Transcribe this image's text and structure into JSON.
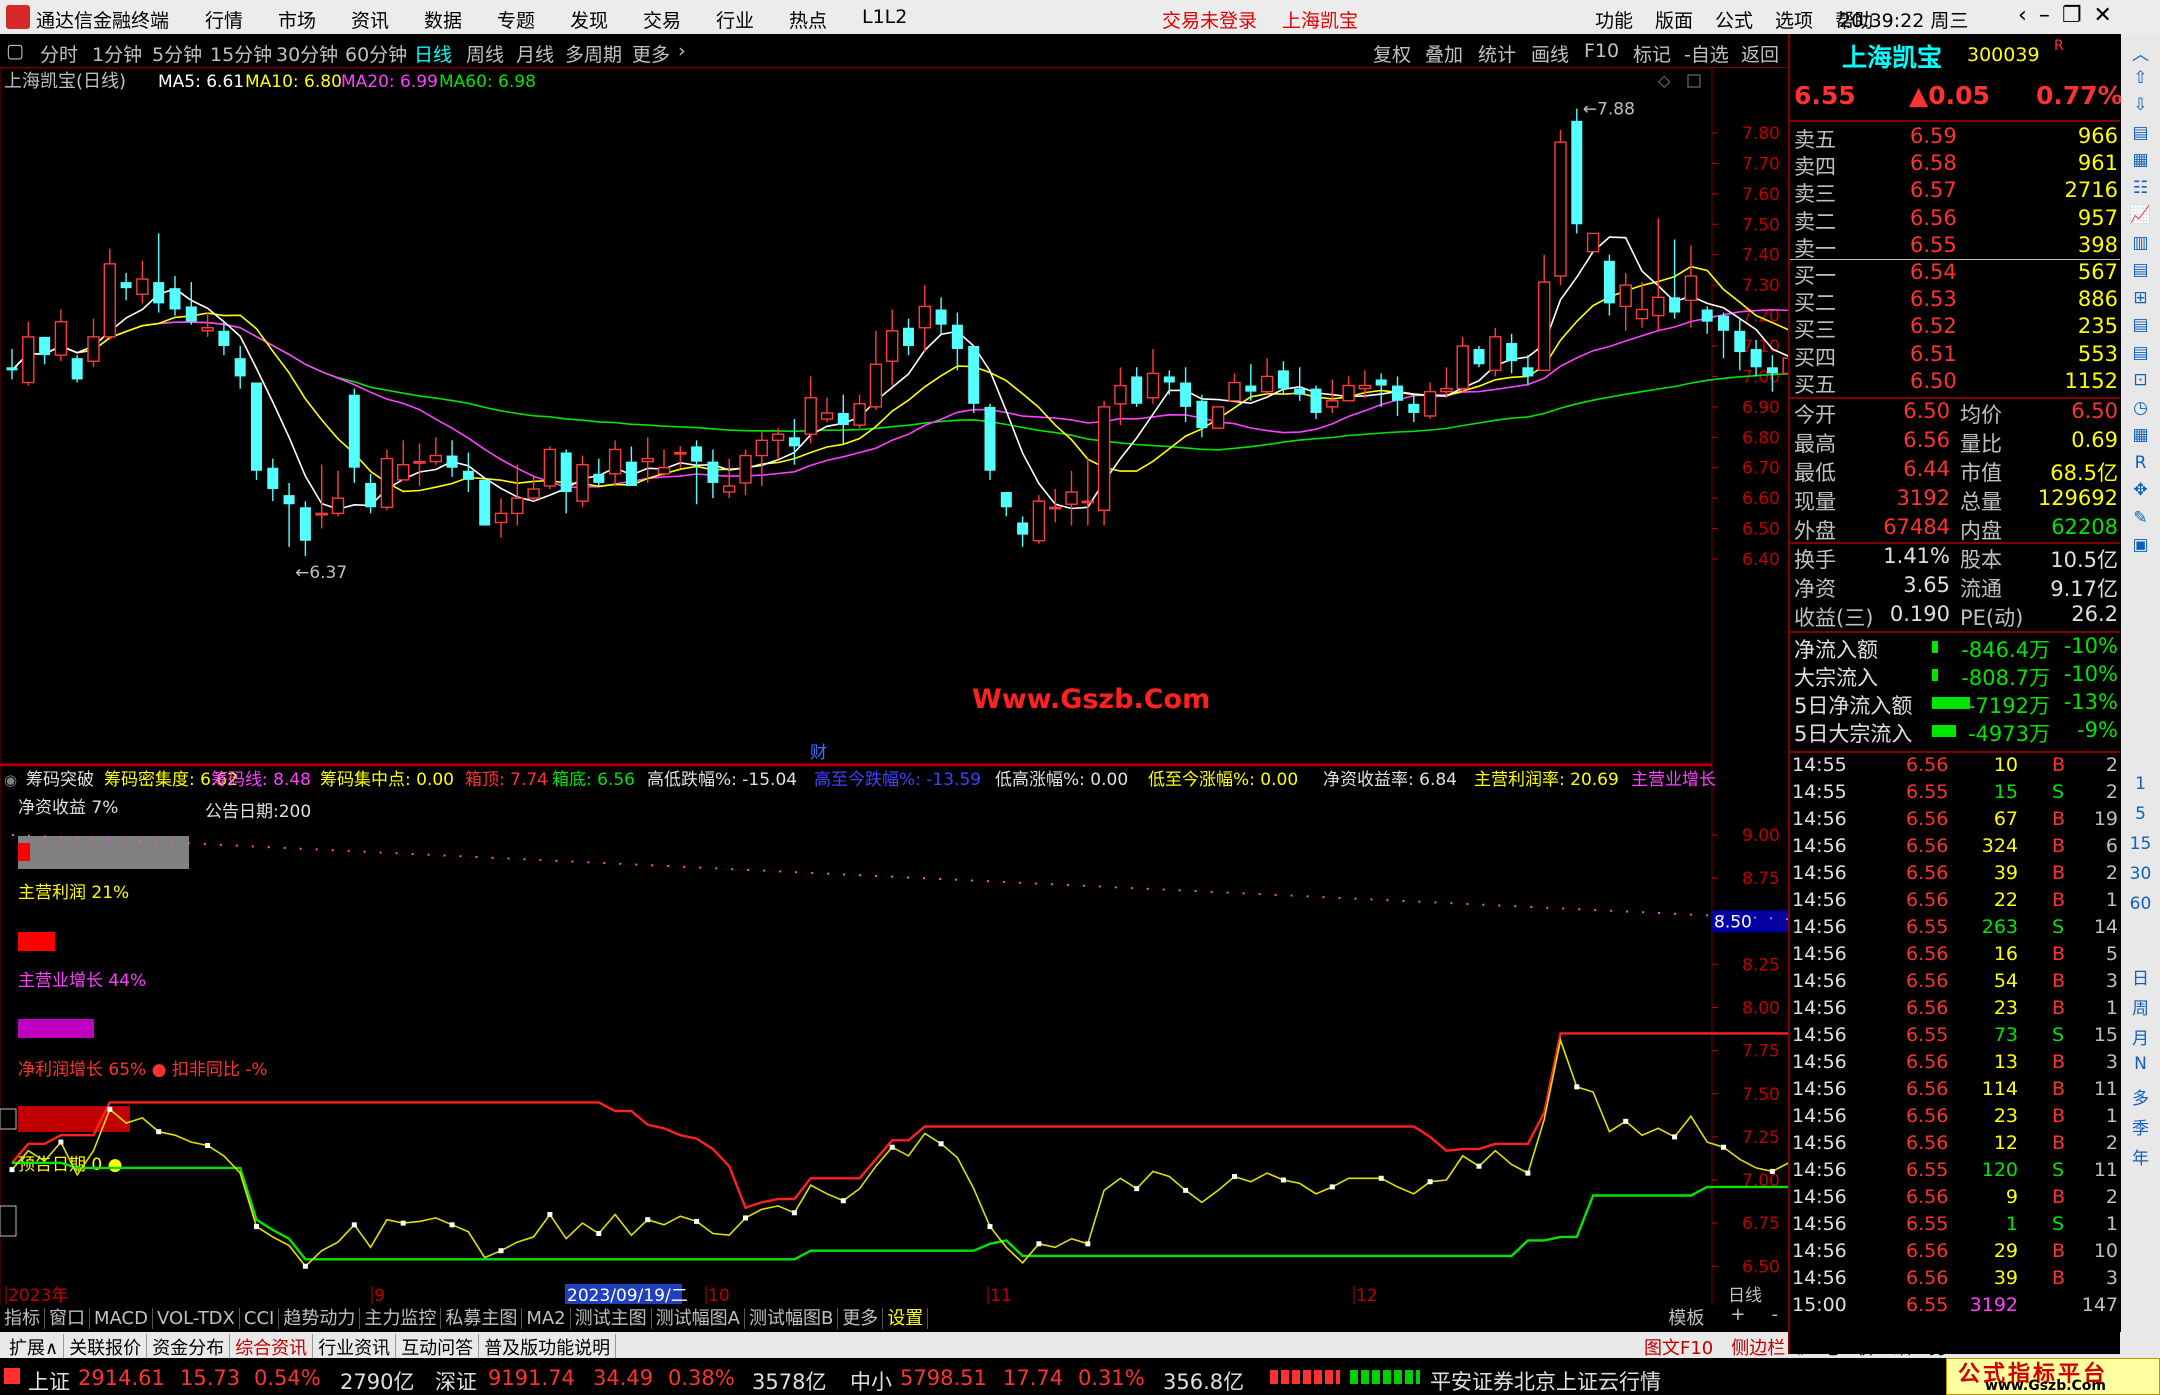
{
  "app": {
    "name": "通达信金融终端",
    "menu": [
      "行情",
      "市场",
      "资讯",
      "数据",
      "专题",
      "发现",
      "交易",
      "行业",
      "热点",
      "L1L2"
    ],
    "trade_status": "交易未登录",
    "stock_title": "上海凯宝",
    "sys_menu": [
      "功能",
      "版面",
      "公式",
      "选项",
      "帮助"
    ],
    "time": "20:39:22",
    "weekday": "周三"
  },
  "periods": [
    "分时",
    "1分钟",
    "5分钟",
    "15分钟",
    "30分钟",
    "60分钟",
    "日线",
    "周线",
    "月线",
    "多周期",
    "更多"
  ],
  "active_period": "日线",
  "tools": [
    "复权",
    "叠加",
    "统计",
    "画线",
    "F10",
    "标记",
    "-自选",
    "返回"
  ],
  "chart": {
    "title": "上海凯宝(日线)",
    "ma5": "MA5: 6.61",
    "ma10": "MA10: 6.80",
    "ma20": "MA20: 6.99",
    "ma60": "MA60: 6.98",
    "high_label": "7.88",
    "low_label": "6.37",
    "watermark": "Www.Gszb.Com",
    "cai": "财",
    "y_ticks": [
      "7.80",
      "7.70",
      "7.60",
      "7.50",
      "7.40",
      "7.30",
      "7.20",
      "7.10",
      "7.00",
      "6.90",
      "6.80",
      "6.70",
      "6.60",
      "6.50",
      "6.40"
    ]
  },
  "indicator": {
    "name": "筹码突破",
    "items": [
      {
        "t": "筹码密集度: 6.62",
        "c": "#ffff00"
      },
      {
        "t": "筹码线: 8.48",
        "c": "#ff40ff"
      },
      {
        "t": "筹码集中点: 0.00",
        "c": "#ffff00"
      },
      {
        "t": "箱顶: 7.74",
        "c": "#ff3232"
      },
      {
        "t": "箱底: 6.56",
        "c": "#00e600"
      },
      {
        "t": "高低跌幅%: -15.04",
        "c": "#e0e0e0"
      },
      {
        "t": "高至今跌幅%: -13.59",
        "c": "#4040ff"
      },
      {
        "t": "低高涨幅%: 0.00",
        "c": "#e0e0e0"
      },
      {
        "t": "低至今涨幅%: 0.00",
        "c": "#ffff00"
      },
      {
        "t": "净资收益率: 6.84",
        "c": "#e0e0e0"
      },
      {
        "t": "主营利润率: 20.69",
        "c": "#ffff00"
      },
      {
        "t": "主营业增长",
        "c": "#ff40ff"
      }
    ],
    "jzsy": "净资收益 7%",
    "ggrq": "公告日期:200",
    "zylr": "主营利润 21%",
    "zyzz": "主营业增长 44%",
    "jlrzz": "净利润增长 65%",
    "kfyb": "扣非同比 -%",
    "ygrq": "预告日期 0",
    "y_ticks": [
      "9.00",
      "8.75",
      "8.50",
      "8.25",
      "8.00",
      "7.75",
      "7.50",
      "7.25",
      "7.00",
      "6.75",
      "6.50"
    ],
    "cur": "8.50"
  },
  "xaxis": {
    "year": "2023年",
    "m9": "9",
    "date": "2023/09/19/二",
    "m10": "10",
    "m11": "11",
    "m12": "12",
    "period": "日线"
  },
  "bottom_tabs": [
    "指标",
    "窗口",
    "MACD",
    "VOL-TDX",
    "CCI",
    "趋势动力",
    "主力监控",
    "私募主图",
    "MA2",
    "测试主图",
    "测试幅图A",
    "测试幅图B",
    "更多",
    "设置"
  ],
  "bottom_right": [
    "模板",
    "+",
    "-"
  ],
  "tabs2": [
    "扩展∧",
    "关联报价",
    "资金分布",
    "综合资讯",
    "行业资讯",
    "互动问答",
    "普及版功能说明"
  ],
  "tabs2_right": [
    "图文F10",
    "侧边栏《",
    "笔",
    "价",
    "细",
    "势"
  ],
  "quote": {
    "name": "上海凯宝",
    "code": "300039",
    "price": "6.55",
    "change": "▲0.05",
    "pct": "0.77%",
    "asks": [
      [
        "卖五",
        "6.59",
        "966"
      ],
      [
        "卖四",
        "6.58",
        "961"
      ],
      [
        "卖三",
        "6.57",
        "2716"
      ],
      [
        "卖二",
        "6.56",
        "957"
      ],
      [
        "卖一",
        "6.55",
        "398"
      ]
    ],
    "bids": [
      [
        "买一",
        "6.54",
        "567"
      ],
      [
        "买二",
        "6.53",
        "886"
      ],
      [
        "买三",
        "6.52",
        "235"
      ],
      [
        "买四",
        "6.51",
        "553"
      ],
      [
        "买五",
        "6.50",
        "1152"
      ]
    ],
    "stats": [
      [
        "今开",
        "6.50",
        "均价",
        "6.50"
      ],
      [
        "最高",
        "6.56",
        "量比",
        "0.69"
      ],
      [
        "最低",
        "6.44",
        "市值",
        "68.5亿"
      ],
      [
        "现量",
        "3192",
        "总量",
        "129692"
      ],
      [
        "外盘",
        "67484",
        "内盘",
        "62208"
      ]
    ],
    "stats2": [
      [
        "换手",
        "1.41%",
        "股本",
        "10.5亿"
      ],
      [
        "净资",
        "3.65",
        "流通",
        "9.17亿"
      ],
      [
        "收益(三)",
        "0.190",
        "PE(动)",
        "26.2"
      ]
    ],
    "flows": [
      [
        "净流入额",
        "-846.4万",
        "-10%"
      ],
      [
        "大宗流入",
        "-808.7万",
        "-10%"
      ],
      [
        "5日净流入额",
        "-7192万",
        "-13%"
      ],
      [
        "5日大宗流入",
        "-4973万",
        "-9%"
      ]
    ],
    "ticks": [
      [
        "14:55",
        "6.56",
        "10",
        "B",
        "2"
      ],
      [
        "14:55",
        "6.55",
        "15",
        "S",
        "2"
      ],
      [
        "14:56",
        "6.56",
        "67",
        "B",
        "19"
      ],
      [
        "14:56",
        "6.56",
        "324",
        "B",
        "6"
      ],
      [
        "14:56",
        "6.56",
        "39",
        "B",
        "2"
      ],
      [
        "14:56",
        "6.56",
        "22",
        "B",
        "1"
      ],
      [
        "14:56",
        "6.55",
        "263",
        "S",
        "14"
      ],
      [
        "14:56",
        "6.56",
        "16",
        "B",
        "5"
      ],
      [
        "14:56",
        "6.56",
        "54",
        "B",
        "3"
      ],
      [
        "14:56",
        "6.56",
        "23",
        "B",
        "1"
      ],
      [
        "14:56",
        "6.55",
        "73",
        "S",
        "15"
      ],
      [
        "14:56",
        "6.56",
        "13",
        "B",
        "3"
      ],
      [
        "14:56",
        "6.56",
        "114",
        "B",
        "11"
      ],
      [
        "14:56",
        "6.56",
        "23",
        "B",
        "1"
      ],
      [
        "14:56",
        "6.56",
        "12",
        "B",
        "2"
      ],
      [
        "14:56",
        "6.55",
        "120",
        "S",
        "11"
      ],
      [
        "14:56",
        "6.56",
        "9",
        "B",
        "2"
      ],
      [
        "14:56",
        "6.55",
        "1",
        "S",
        "1"
      ],
      [
        "14:56",
        "6.56",
        "29",
        "B",
        "10"
      ],
      [
        "14:56",
        "6.56",
        "39",
        "B",
        "3"
      ],
      [
        "15:00",
        "6.55",
        "3192",
        "",
        "147"
      ]
    ]
  },
  "sidebar": [
    "日",
    "周",
    "月",
    "N",
    "多",
    "季",
    "年"
  ],
  "sidebar_nums": [
    "1",
    "5",
    "15",
    "30",
    "60"
  ],
  "status": {
    "sh_label": "上证",
    "sh": "2914.61",
    "sh_chg": "15.73",
    "sh_pct": "0.54%",
    "sh_amt": "2790亿",
    "sz_label": "深证",
    "sz": "9191.74",
    "sz_chg": "34.49",
    "sz_pct": "0.38%",
    "sz_amt": "3578亿",
    "zx_label": "中小",
    "zx": "5798.51",
    "zx_chg": "17.74",
    "zx_pct": "0.31%",
    "zx_amt": "356.8亿",
    "broker": "平安证券北京上证云行情",
    "brand": "公式指标平台",
    "brand_url": "www.Gszb.Com"
  },
  "chart_data": {
    "type": "candlestick",
    "ma_colors": {
      "ma5": "#ffffff",
      "ma10": "#ffff00",
      "ma20": "#ff40ff",
      "ma60": "#00e600"
    },
    "candles": [
      [
        7.03,
        7.02,
        7.09,
        6.99
      ],
      [
        6.98,
        7.13,
        7.18,
        6.97
      ],
      [
        7.13,
        7.07,
        7.11,
        7.04
      ],
      [
        7.07,
        7.18,
        7.22,
        7.05
      ],
      [
        7.06,
        6.99,
        7.07,
        6.98
      ],
      [
        7.05,
        7.13,
        7.19,
        7.03
      ],
      [
        7.13,
        7.37,
        7.42,
        7.12
      ],
      [
        7.31,
        7.29,
        7.34,
        7.25
      ],
      [
        7.27,
        7.32,
        7.38,
        7.24
      ],
      [
        7.31,
        7.24,
        7.47,
        7.21
      ],
      [
        7.29,
        7.22,
        7.33,
        7.2
      ],
      [
        7.23,
        7.18,
        7.31,
        7.17
      ],
      [
        7.15,
        7.16,
        7.21,
        7.13
      ],
      [
        7.15,
        7.1,
        7.18,
        7.07
      ],
      [
        7.06,
        7.0,
        7.1,
        6.96
      ],
      [
        6.98,
        6.69,
        6.98,
        6.66
      ],
      [
        6.7,
        6.63,
        6.73,
        6.59
      ],
      [
        6.61,
        6.58,
        6.65,
        6.44
      ],
      [
        6.57,
        6.46,
        6.59,
        6.41
      ],
      [
        6.55,
        6.55,
        6.71,
        6.5
      ],
      [
        6.55,
        6.6,
        6.69,
        6.54
      ],
      [
        6.94,
        6.7,
        6.96,
        6.65
      ],
      [
        6.65,
        6.57,
        6.68,
        6.55
      ],
      [
        6.57,
        6.73,
        6.76,
        6.56
      ],
      [
        6.66,
        6.71,
        6.79,
        6.66
      ],
      [
        6.72,
        6.72,
        6.78,
        6.64
      ],
      [
        6.72,
        6.74,
        6.8,
        6.71
      ],
      [
        6.74,
        6.7,
        6.79,
        6.67
      ],
      [
        6.69,
        6.66,
        6.75,
        6.62
      ],
      [
        6.66,
        6.51,
        6.66,
        6.51
      ],
      [
        6.52,
        6.55,
        6.6,
        6.47
      ],
      [
        6.55,
        6.6,
        6.71,
        6.51
      ],
      [
        6.6,
        6.63,
        6.67,
        6.59
      ],
      [
        6.64,
        6.76,
        6.77,
        6.63
      ],
      [
        6.75,
        6.62,
        6.76,
        6.55
      ],
      [
        6.59,
        6.71,
        6.74,
        6.57
      ],
      [
        6.68,
        6.65,
        6.73,
        6.64
      ],
      [
        6.68,
        6.76,
        6.79,
        6.64
      ],
      [
        6.72,
        6.64,
        6.77,
        6.64
      ],
      [
        6.72,
        6.73,
        6.8,
        6.65
      ],
      [
        6.68,
        6.7,
        6.76,
        6.67
      ],
      [
        6.75,
        6.75,
        6.77,
        6.7
      ],
      [
        6.77,
        6.72,
        6.79,
        6.58
      ],
      [
        6.72,
        6.65,
        6.76,
        6.6
      ],
      [
        6.62,
        6.64,
        6.73,
        6.6
      ],
      [
        6.65,
        6.74,
        6.76,
        6.61
      ],
      [
        6.74,
        6.79,
        6.82,
        6.64
      ],
      [
        6.79,
        6.81,
        6.83,
        6.73
      ],
      [
        6.8,
        6.77,
        6.86,
        6.71
      ],
      [
        6.81,
        6.93,
        7.0,
        6.78
      ],
      [
        6.86,
        6.88,
        6.93,
        6.85
      ],
      [
        6.88,
        6.84,
        6.94,
        6.78
      ],
      [
        6.84,
        6.91,
        6.94,
        6.83
      ],
      [
        6.9,
        7.04,
        7.15,
        6.89
      ],
      [
        7.05,
        7.15,
        7.22,
        6.97
      ],
      [
        7.16,
        7.1,
        7.19,
        7.07
      ],
      [
        7.16,
        7.23,
        7.3,
        7.08
      ],
      [
        7.22,
        7.17,
        7.26,
        7.14
      ],
      [
        7.17,
        7.09,
        7.21,
        7.02
      ],
      [
        7.1,
        6.91,
        7.1,
        6.88
      ],
      [
        6.9,
        6.69,
        6.91,
        6.66
      ],
      [
        6.62,
        6.57,
        6.62,
        6.54
      ],
      [
        6.52,
        6.48,
        6.54,
        6.44
      ],
      [
        6.46,
        6.59,
        6.61,
        6.45
      ],
      [
        6.57,
        6.57,
        6.63,
        6.52
      ],
      [
        6.58,
        6.62,
        6.69,
        6.51
      ],
      [
        6.59,
        6.59,
        6.73,
        6.51
      ],
      [
        6.56,
        6.9,
        6.92,
        6.51
      ],
      [
        6.91,
        6.97,
        7.03,
        6.84
      ],
      [
        7.0,
        6.91,
        7.03,
        6.9
      ],
      [
        6.93,
        7.01,
        7.09,
        6.91
      ],
      [
        7.0,
        6.98,
        7.02,
        6.94
      ],
      [
        6.98,
        6.9,
        7.03,
        6.85
      ],
      [
        6.92,
        6.83,
        6.94,
        6.8
      ],
      [
        6.83,
        6.9,
        6.9,
        6.83
      ],
      [
        6.92,
        6.98,
        7.01,
        6.94
      ],
      [
        6.97,
        6.95,
        7.04,
        6.92
      ],
      [
        6.95,
        7.0,
        7.06,
        6.94
      ],
      [
        7.02,
        6.96,
        7.05,
        6.94
      ],
      [
        6.96,
        6.94,
        7.03,
        6.92
      ],
      [
        6.96,
        6.88,
        6.97,
        6.86
      ],
      [
        6.9,
        6.92,
        6.99,
        6.88
      ],
      [
        6.92,
        6.97,
        7.0,
        6.92
      ],
      [
        6.96,
        6.97,
        7.02,
        6.93
      ],
      [
        6.99,
        6.97,
        7.01,
        6.9
      ],
      [
        6.97,
        6.92,
        7.0,
        6.87
      ],
      [
        6.91,
        6.88,
        6.94,
        6.85
      ],
      [
        6.87,
        6.95,
        6.98,
        6.86
      ],
      [
        6.95,
        6.96,
        7.03,
        6.93
      ],
      [
        6.96,
        7.1,
        7.13,
        6.95
      ],
      [
        7.09,
        7.04,
        7.1,
        7.03
      ],
      [
        7.02,
        7.13,
        7.16,
        7.0
      ],
      [
        7.11,
        7.05,
        7.14,
        7.01
      ],
      [
        7.03,
        7.0,
        7.07,
        6.97
      ],
      [
        7.02,
        7.31,
        7.4,
        7.02
      ],
      [
        7.33,
        7.77,
        7.81,
        7.3
      ],
      [
        7.84,
        7.5,
        7.88,
        7.47
      ],
      [
        7.41,
        7.47,
        7.47,
        7.42
      ],
      [
        7.38,
        7.24,
        7.4,
        7.2
      ],
      [
        7.23,
        7.3,
        7.34,
        7.15
      ],
      [
        7.19,
        7.22,
        7.31,
        7.16
      ],
      [
        7.2,
        7.26,
        7.52,
        7.15
      ],
      [
        7.26,
        7.21,
        7.45,
        7.19
      ],
      [
        7.25,
        7.33,
        7.43,
        7.16
      ],
      [
        7.22,
        7.18,
        7.23,
        7.14
      ],
      [
        7.2,
        7.15,
        7.21,
        7.06
      ],
      [
        7.15,
        7.08,
        7.19,
        7.02
      ],
      [
        7.09,
        7.03,
        7.12,
        7.0
      ],
      [
        7.03,
        7.01,
        7.07,
        6.95
      ],
      [
        7.01,
        7.06,
        7.14,
        7.0
      ],
      [
        7.06,
        7.33,
        7.58,
        7.05
      ],
      [
        7.25,
        7.09,
        7.58,
        7.04
      ],
      [
        7.07,
        7.29,
        7.32,
        7.03
      ],
      [
        7.27,
        7.02,
        7.34,
        7.01
      ],
      [
        6.98,
        6.98,
        7.03,
        6.96
      ],
      [
        6.96,
        6.84,
        7.02,
        6.79
      ],
      [
        6.84,
        6.79,
        6.87,
        6.78
      ],
      [
        6.79,
        6.73,
        6.79,
        6.68
      ],
      [
        6.73,
        6.63,
        6.75,
        6.6
      ],
      [
        6.64,
        6.64,
        6.67,
        6.59
      ],
      [
        6.61,
        6.6,
        6.65,
        6.57
      ],
      [
        6.6,
        6.51,
        6.61,
        6.49
      ],
      [
        6.5,
        6.55,
        6.56,
        6.44
      ]
    ]
  }
}
